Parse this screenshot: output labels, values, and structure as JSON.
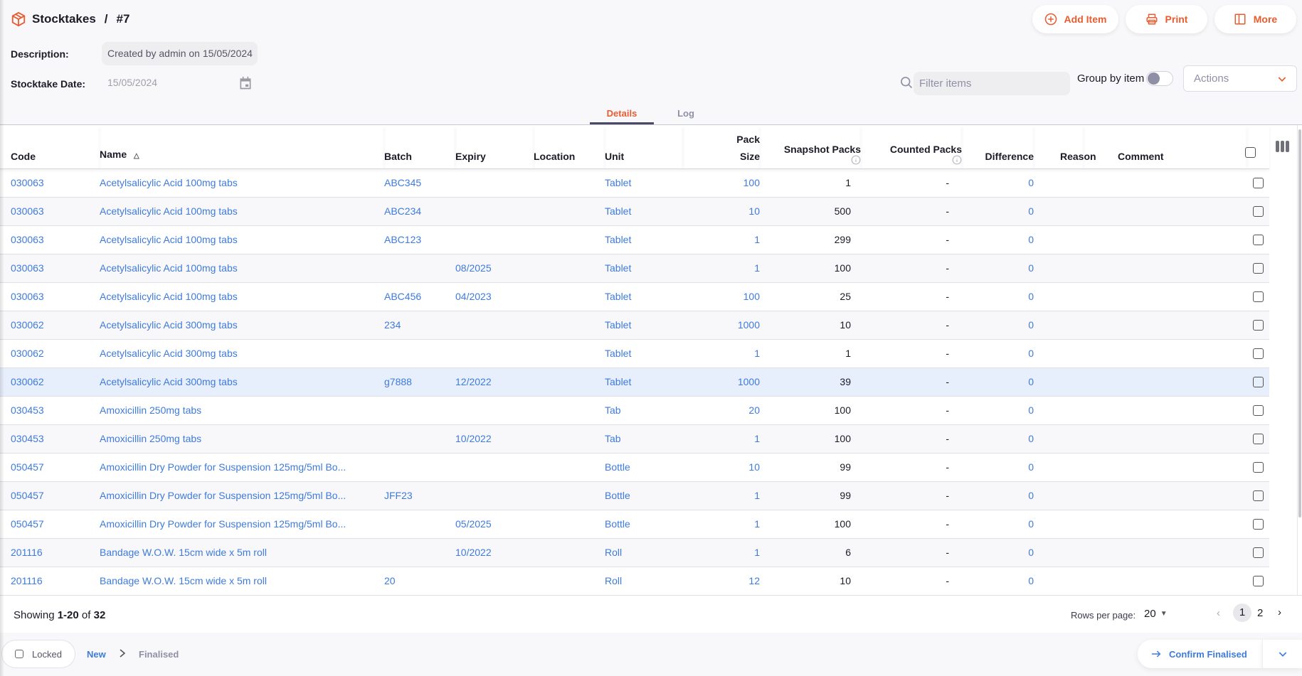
{
  "header": {
    "section": "Stocktakes",
    "separator": "/",
    "record": "#7",
    "buttons": {
      "add_item": "Add Item",
      "print": "Print",
      "more": "More"
    }
  },
  "form": {
    "description_label": "Description:",
    "description_value": "Created by admin on 15/05/2024",
    "date_label": "Stocktake Date:",
    "date_value": "15/05/2024"
  },
  "filters": {
    "search_placeholder": "Filter items",
    "group_by_label": "Group by item",
    "group_by_on": false,
    "actions_label": "Actions"
  },
  "tabs": [
    {
      "label": "Details",
      "active": true
    },
    {
      "label": "Log",
      "active": false
    }
  ],
  "colors": {
    "accent": "#e95c30",
    "link": "#3e7bdb",
    "selected_row": "#e8effc"
  },
  "table": {
    "columns": {
      "code": "Code",
      "name": "Name",
      "batch": "Batch",
      "expiry": "Expiry",
      "location": "Location",
      "unit": "Unit",
      "pack_size_1": "Pack",
      "pack_size_2": "Size",
      "snapshot": "Snapshot Packs",
      "counted": "Counted Packs",
      "difference": "Difference",
      "reason": "Reason",
      "comment": "Comment"
    },
    "sort": {
      "column": "name",
      "direction": "asc"
    },
    "rows": [
      {
        "code": "030063",
        "name": "Acetylsalicylic Acid 100mg tabs",
        "batch": "ABC345",
        "expiry": "",
        "location": "",
        "unit": "Tablet",
        "pack_size": "100",
        "snapshot": "1",
        "counted": "-",
        "difference": "0",
        "reason": "",
        "comment": "",
        "checked": false
      },
      {
        "code": "030063",
        "name": "Acetylsalicylic Acid 100mg tabs",
        "batch": "ABC234",
        "expiry": "",
        "location": "",
        "unit": "Tablet",
        "pack_size": "10",
        "snapshot": "500",
        "counted": "-",
        "difference": "0",
        "reason": "",
        "comment": "",
        "checked": false
      },
      {
        "code": "030063",
        "name": "Acetylsalicylic Acid 100mg tabs",
        "batch": "ABC123",
        "expiry": "",
        "location": "",
        "unit": "Tablet",
        "pack_size": "1",
        "snapshot": "299",
        "counted": "-",
        "difference": "0",
        "reason": "",
        "comment": "",
        "checked": false
      },
      {
        "code": "030063",
        "name": "Acetylsalicylic Acid 100mg tabs",
        "batch": "",
        "expiry": "08/2025",
        "location": "",
        "unit": "Tablet",
        "pack_size": "1",
        "snapshot": "100",
        "counted": "-",
        "difference": "0",
        "reason": "",
        "comment": "",
        "checked": false
      },
      {
        "code": "030063",
        "name": "Acetylsalicylic Acid 100mg tabs",
        "batch": "ABC456",
        "expiry": "04/2023",
        "location": "",
        "unit": "Tablet",
        "pack_size": "100",
        "snapshot": "25",
        "counted": "-",
        "difference": "0",
        "reason": "",
        "comment": "",
        "checked": false
      },
      {
        "code": "030062",
        "name": "Acetylsalicylic Acid 300mg tabs",
        "batch": "234",
        "expiry": "",
        "location": "",
        "unit": "Tablet",
        "pack_size": "1000",
        "snapshot": "10",
        "counted": "-",
        "difference": "0",
        "reason": "",
        "comment": "",
        "checked": false
      },
      {
        "code": "030062",
        "name": "Acetylsalicylic Acid 300mg tabs",
        "batch": "",
        "expiry": "",
        "location": "",
        "unit": "Tablet",
        "pack_size": "1",
        "snapshot": "1",
        "counted": "-",
        "difference": "0",
        "reason": "",
        "comment": "",
        "checked": false
      },
      {
        "code": "030062",
        "name": "Acetylsalicylic Acid 300mg tabs",
        "batch": "g7888",
        "expiry": "12/2022",
        "location": "",
        "unit": "Tablet",
        "pack_size": "1000",
        "snapshot": "39",
        "counted": "-",
        "difference": "0",
        "reason": "",
        "comment": "",
        "checked": false,
        "selected": true
      },
      {
        "code": "030453",
        "name": "Amoxicillin 250mg tabs",
        "batch": "",
        "expiry": "",
        "location": "",
        "unit": "Tab",
        "pack_size": "20",
        "snapshot": "100",
        "counted": "-",
        "difference": "0",
        "reason": "",
        "comment": "",
        "checked": false
      },
      {
        "code": "030453",
        "name": "Amoxicillin 250mg tabs",
        "batch": "",
        "expiry": "10/2022",
        "location": "",
        "unit": "Tab",
        "pack_size": "1",
        "snapshot": "100",
        "counted": "-",
        "difference": "0",
        "reason": "",
        "comment": "",
        "checked": false
      },
      {
        "code": "050457",
        "name": "Amoxicillin Dry Powder for Suspension 125mg/5ml Bo...",
        "batch": "",
        "expiry": "",
        "location": "",
        "unit": "Bottle",
        "pack_size": "10",
        "snapshot": "99",
        "counted": "-",
        "difference": "0",
        "reason": "",
        "comment": "",
        "checked": false
      },
      {
        "code": "050457",
        "name": "Amoxicillin Dry Powder for Suspension 125mg/5ml Bo...",
        "batch": "JFF23",
        "expiry": "",
        "location": "",
        "unit": "Bottle",
        "pack_size": "1",
        "snapshot": "99",
        "counted": "-",
        "difference": "0",
        "reason": "",
        "comment": "",
        "checked": false
      },
      {
        "code": "050457",
        "name": "Amoxicillin Dry Powder for Suspension 125mg/5ml Bo...",
        "batch": "",
        "expiry": "05/2025",
        "location": "",
        "unit": "Bottle",
        "pack_size": "1",
        "snapshot": "100",
        "counted": "-",
        "difference": "0",
        "reason": "",
        "comment": "",
        "checked": false
      },
      {
        "code": "201116",
        "name": "Bandage W.O.W. 15cm wide x 5m roll",
        "batch": "",
        "expiry": "10/2022",
        "location": "",
        "unit": "Roll",
        "pack_size": "1",
        "snapshot": "6",
        "counted": "-",
        "difference": "0",
        "reason": "",
        "comment": "",
        "checked": false
      },
      {
        "code": "201116",
        "name": "Bandage W.O.W. 15cm wide x 5m roll",
        "batch": "20",
        "expiry": "",
        "location": "",
        "unit": "Roll",
        "pack_size": "12",
        "snapshot": "10",
        "counted": "-",
        "difference": "0",
        "reason": "",
        "comment": "",
        "checked": false
      }
    ]
  },
  "pagination": {
    "showing_prefix": "Showing ",
    "range": "1-20",
    "of_text": " of ",
    "total": "32",
    "rows_per_page_label": "Rows per page:",
    "rows_per_page": "20",
    "pages": [
      "1",
      "2"
    ],
    "current_page": "1"
  },
  "status_bar": {
    "locked_label": "Locked",
    "locked": false,
    "status_new": "New",
    "status_finalised": "Finalised",
    "confirm_label": "Confirm Finalised"
  }
}
